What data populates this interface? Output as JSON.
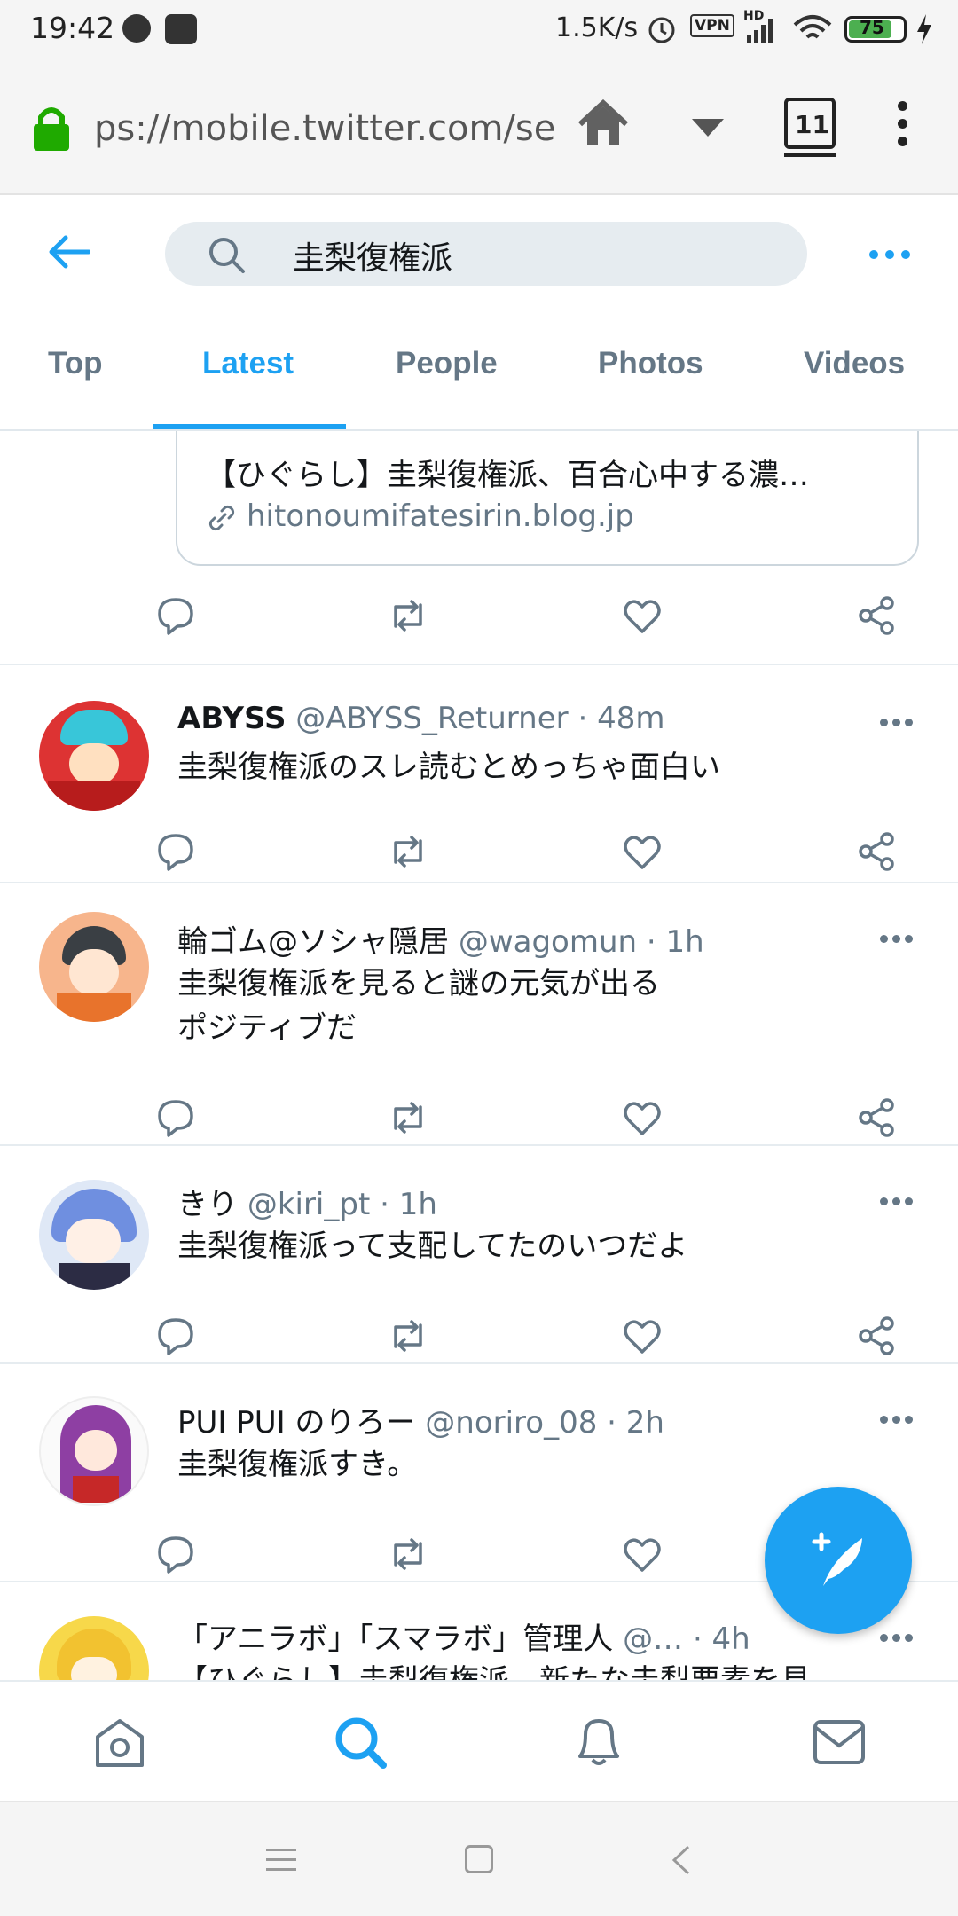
{
  "status_bar": {
    "time": "19:42",
    "speed": "1.5K/s",
    "vpn": "VPN",
    "hd": "HD",
    "battery": "75"
  },
  "browser": {
    "url": "ps://mobile.twitter.com/se",
    "tab_count": "11"
  },
  "search": {
    "query": "圭梨復権派"
  },
  "tabs": [
    {
      "label": "Top"
    },
    {
      "label": "Latest"
    },
    {
      "label": "People"
    },
    {
      "label": "Photos"
    },
    {
      "label": "Videos"
    }
  ],
  "active_tab": "Latest",
  "partial_card": {
    "title": "【ひぐらし】圭梨復権派、百合心中する濃…",
    "domain": "hitonoumifatesirin.blog.jp"
  },
  "tweets": [
    {
      "name": "ABYSS",
      "handle": "@ABYSS_Returner",
      "time": "· 48m",
      "text": [
        "圭梨復権派のスレ読むとめっちゃ面白い"
      ]
    },
    {
      "name": "輪ゴム@ソシャ隠居",
      "handle": "@wagomun",
      "time": "· 1h",
      "text": [
        "圭梨復権派を見ると謎の元気が出る",
        "ポジティブだ"
      ]
    },
    {
      "name": "きり",
      "handle": "@kiri_pt",
      "time": "· 1h",
      "text": [
        "圭梨復権派って支配してたのいつだよ"
      ]
    },
    {
      "name": "PUI PUI のりろー",
      "handle": "@noriro_08",
      "time": "· 2h",
      "text": [
        "圭梨復権派すき。"
      ]
    },
    {
      "name": "「アニラボ」「スマラボ」管理人",
      "handle": "@…",
      "time": "· 4h",
      "text": [
        "【ひぐらし】圭梨復権派、新たな圭梨要素を見"
      ]
    }
  ],
  "colors": {
    "accent": "#1da1f2",
    "secondary": "#657786"
  }
}
